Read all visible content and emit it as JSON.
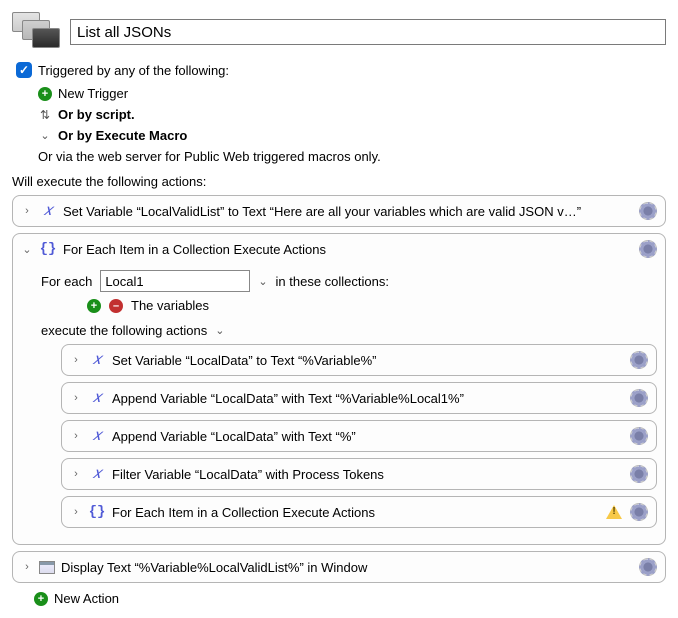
{
  "title": "List all JSONs",
  "trigger": {
    "anyOfLabel": "Triggered by any of the following:",
    "newTriggerLabel": "New Trigger",
    "scriptLabel": "Or by script.",
    "executeMacroLabel": "Or by Execute Macro",
    "webServerLabel": "Or via the web server for Public Web triggered macros only."
  },
  "actionsHeading": "Will execute the following actions:",
  "actions": {
    "a0": "Set Variable “LocalValidList” to Text “Here are all your variables which are valid JSON v…”",
    "a1": {
      "title": "For Each Item in a Collection Execute Actions",
      "forLabel": "For each",
      "varName": "Local1",
      "inCollectionsLabel": "in these collections:",
      "collectionLabel": "The variables",
      "executeLabel": "execute the following actions",
      "children": {
        "c0": "Set Variable “LocalData” to Text “%Variable%”",
        "c1": "Append Variable “LocalData” with Text “%Variable%Local1%”",
        "c2": "Append Variable “LocalData” with Text “%”",
        "c3": "Filter Variable “LocalData” with Process Tokens",
        "c4": "For Each Item in a Collection Execute Actions"
      }
    },
    "a2": "Display Text “%Variable%LocalValidList%” in Window"
  },
  "newActionLabel": "New Action"
}
